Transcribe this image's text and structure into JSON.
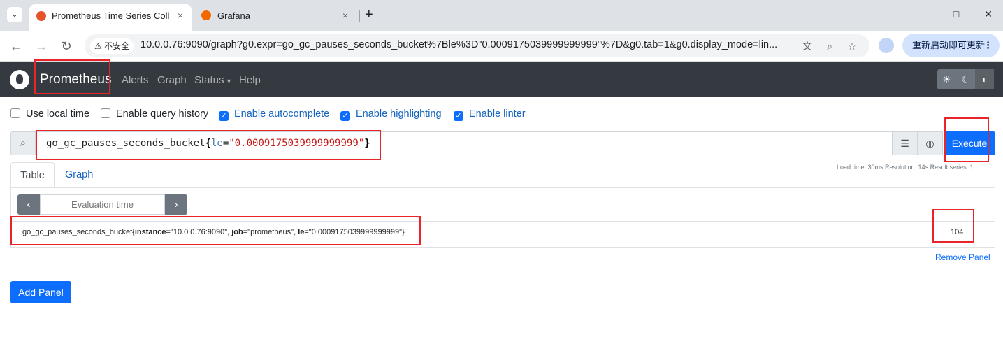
{
  "browser": {
    "tabs": [
      {
        "title": "Prometheus Time Series Colle",
        "close": "×",
        "active": true
      },
      {
        "title": "Grafana",
        "close": "×",
        "active": false
      }
    ],
    "new_tab": "+",
    "window_controls": {
      "minimize": "–",
      "maximize": "□",
      "close": "✕"
    },
    "security_label": "不安全",
    "url": "10.0.0.76:9090/graph?g0.expr=go_gc_pauses_seconds_bucket%7Ble%3D\"0.0009175039999999999\"%7D&g0.tab=1&g0.display_mode=lin...",
    "update_button": "重新启动即可更新"
  },
  "navbar": {
    "brand": "Prometheus",
    "links": [
      "Alerts",
      "Graph",
      "Status",
      "Help"
    ]
  },
  "options": [
    {
      "label": "Use local time",
      "checked": false
    },
    {
      "label": "Enable query history",
      "checked": false
    },
    {
      "label": "Enable autocomplete",
      "checked": true
    },
    {
      "label": "Enable highlighting",
      "checked": true
    },
    {
      "label": "Enable linter",
      "checked": true
    }
  ],
  "query": {
    "metric": "go_gc_pauses_seconds_bucket",
    "open_brace": "{",
    "label": "le",
    "op": "=",
    "value": "\"0.0009175039999999999\"",
    "close_brace": "}"
  },
  "execute_label": "Execute",
  "stats": "Load time: 30ms   Resolution: 14s   Result series: 1",
  "panel": {
    "tabs": [
      "Table",
      "Graph"
    ],
    "eval_placeholder": "Evaluation time",
    "result": {
      "metric": "go_gc_pauses_seconds_bucket{",
      "instance_key": "instance",
      "instance_val": "=\"10.0.0.76:9090\", ",
      "job_key": "job",
      "job_val": "=\"prometheus\", ",
      "le_key": "le",
      "le_val": "=\"0.0009175039999999999\"}",
      "value": "104"
    },
    "remove_label": "Remove Panel"
  },
  "add_panel_label": "Add Panel"
}
